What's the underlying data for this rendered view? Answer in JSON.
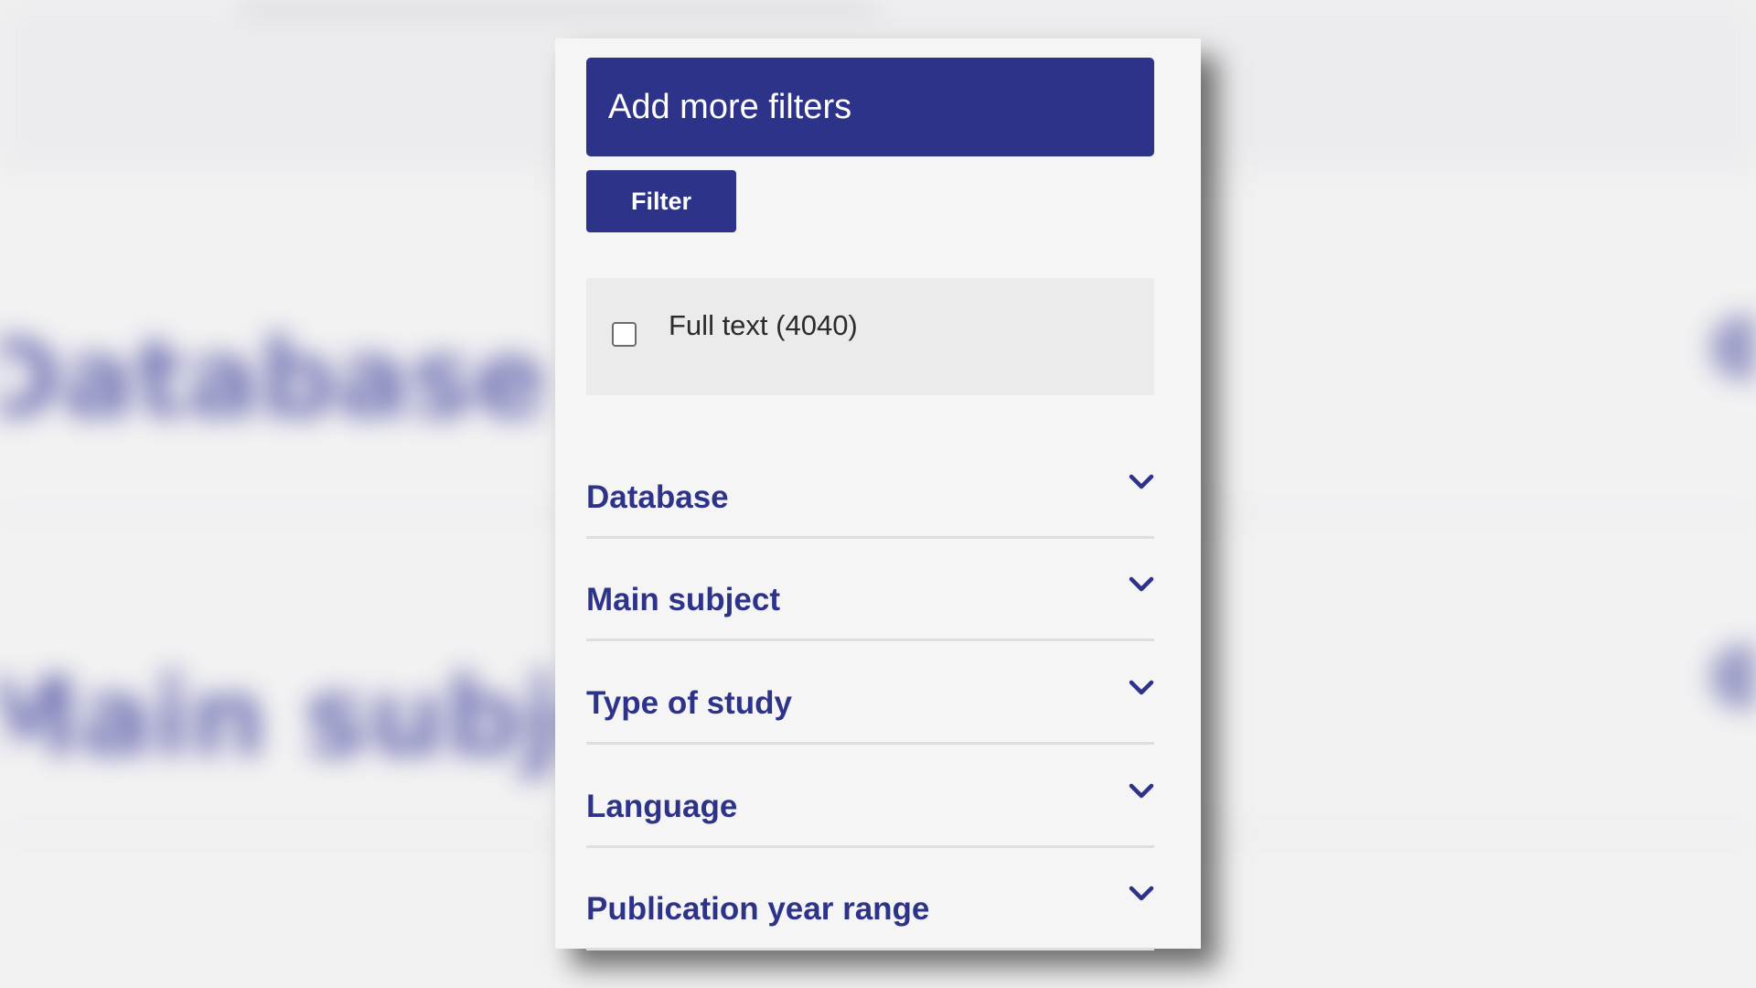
{
  "panel": {
    "add_more_filters": "Add more filters",
    "filter_button": "Filter",
    "fulltext_label": "Full text (4040)",
    "fulltext_checked": false,
    "sections": [
      {
        "label": "Database",
        "icon": "chevron-down-icon"
      },
      {
        "label": "Main subject",
        "icon": "chevron-down-icon"
      },
      {
        "label": "Type of study",
        "icon": "chevron-down-icon"
      },
      {
        "label": "Language",
        "icon": "chevron-down-icon"
      },
      {
        "label": "Publication year range",
        "icon": "chevron-down-icon"
      }
    ]
  },
  "colors": {
    "primary": "#2e338a",
    "panel_bg": "#f5f5f5",
    "fulltext_bg": "#ebebeb",
    "page_bg": "#f2f2f3"
  }
}
